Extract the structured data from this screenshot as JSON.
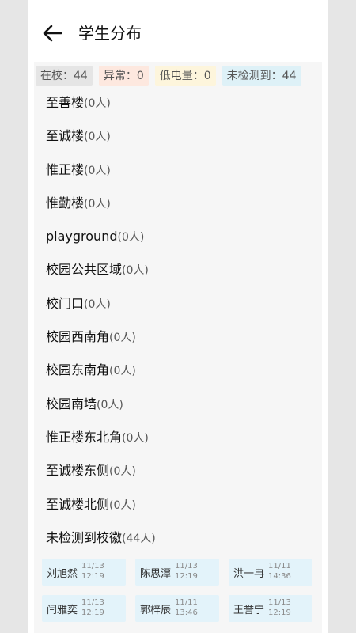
{
  "header": {
    "title": "学生分布",
    "back_icon": "arrow-left-icon"
  },
  "stats": {
    "total": "在校：44",
    "abnormal": "异常：0",
    "low_power": "低电量：0",
    "undetected": "未检测到：44"
  },
  "buildings": [
    {
      "name": "至善楼",
      "count": "(0人)"
    },
    {
      "name": "至诚楼",
      "count": "(0人)"
    },
    {
      "name": "惟正楼",
      "count": "(0人)"
    },
    {
      "name": "惟勤楼",
      "count": "(0人)"
    },
    {
      "name": "playground",
      "count": "(0人)"
    },
    {
      "name": "校园公共区域",
      "count": "(0人)"
    },
    {
      "name": "校门口",
      "count": "(0人)"
    },
    {
      "name": "校园西南角",
      "count": "(0人)"
    },
    {
      "name": "校园东南角",
      "count": "(0人)"
    },
    {
      "name": "校园南墙",
      "count": "(0人)"
    },
    {
      "name": "惟正楼东北角",
      "count": "(0人)"
    },
    {
      "name": "至诚楼东侧",
      "count": "(0人)"
    },
    {
      "name": "至诚楼北侧",
      "count": "(0人)"
    },
    {
      "name": "未检测到校徽",
      "count": "(44人)"
    }
  ],
  "students": [
    {
      "name": "刘旭然",
      "date": "11/13",
      "time": "12:19"
    },
    {
      "name": "陈思潭",
      "date": "11/13",
      "time": "12:19"
    },
    {
      "name": "洪一冉",
      "date": "11/11",
      "time": "14:36"
    },
    {
      "name": "闫雅奕",
      "date": "11/13",
      "time": "12:19"
    },
    {
      "name": "郭梓辰",
      "date": "11/11",
      "time": "13:46"
    },
    {
      "name": "王誉宁",
      "date": "11/13",
      "time": "12:19"
    }
  ]
}
